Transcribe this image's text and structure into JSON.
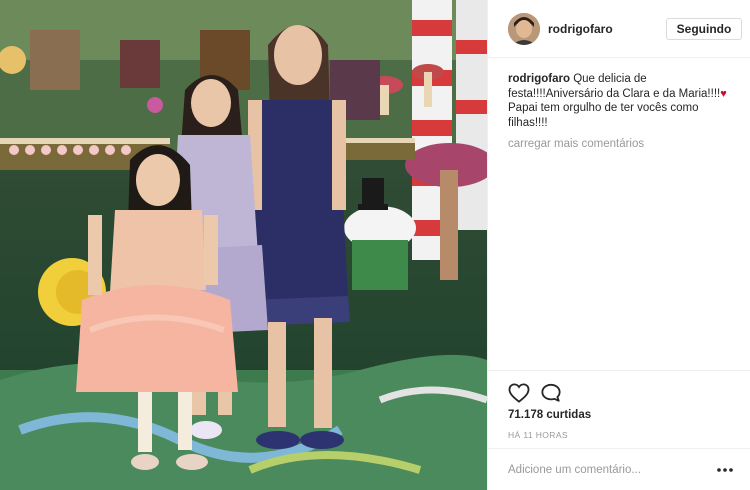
{
  "post": {
    "photo": {
      "alt_icon": "party-photo"
    },
    "header": {
      "username": "rodrigofaro",
      "follow_label": "Seguindo"
    },
    "caption": {
      "username": "rodrigofaro",
      "text": "Que delicia de festa!!!!Aniversário da Clara e da Maria!!!!",
      "text_after_emoji": "Papai tem orgulho de ter vocês como filhas!!!!",
      "emoji": "♥"
    },
    "load_more_label": "carregar mais comentários",
    "actions": {
      "like_icon": "heart-icon",
      "comment_icon": "comment-icon",
      "likes_label": "71.178 curtidas",
      "time_label": "HÁ 11 HORAS"
    },
    "add_comment": {
      "placeholder": "Adicione um comentário...",
      "more_icon": "more-icon"
    }
  },
  "colors": {
    "border": "#efefef",
    "muted": "#999999",
    "text": "#262626",
    "heart_emoji": "#c8102e"
  }
}
